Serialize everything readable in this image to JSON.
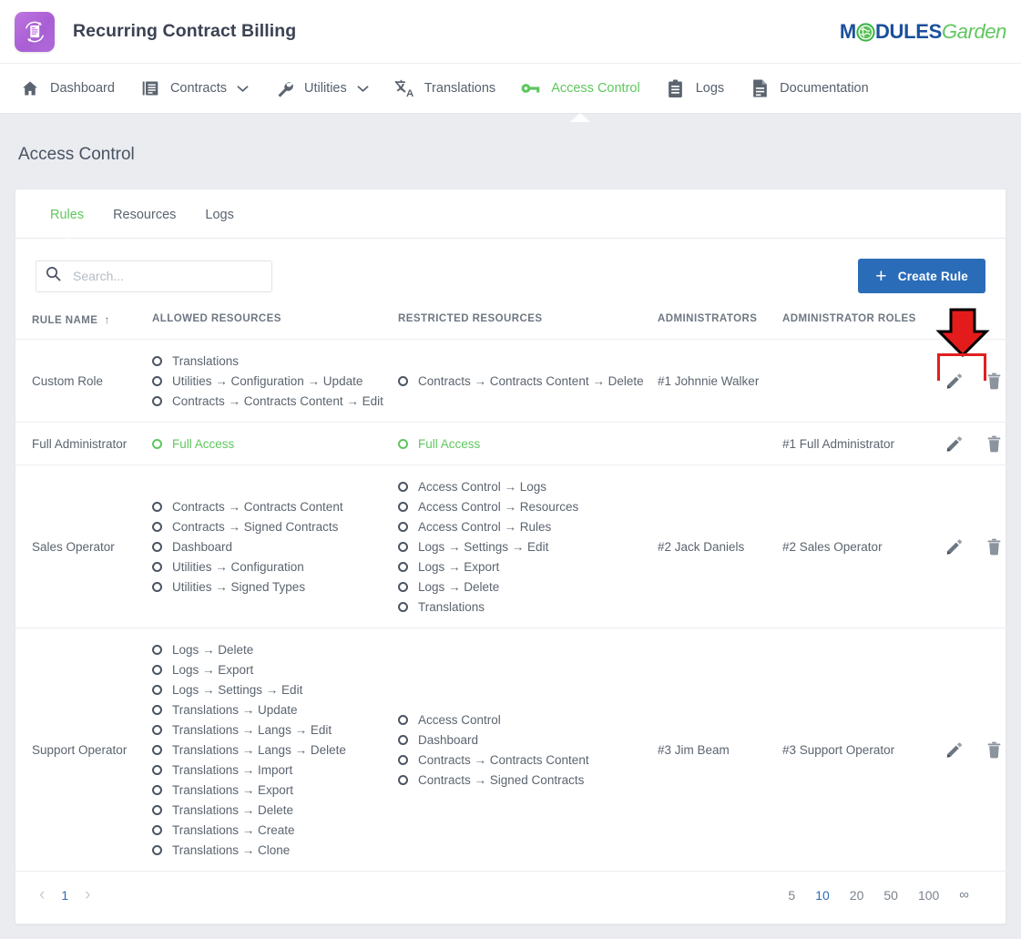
{
  "header": {
    "app_title": "Recurring Contract Billing",
    "app_icon": "recurring-document-icon",
    "logo": {
      "part1": "M",
      "part2": "DULES",
      "part3": "Garden"
    }
  },
  "nav": {
    "items": [
      {
        "label": "Dashboard",
        "icon": "home-icon",
        "active": false,
        "caret": false
      },
      {
        "label": "Contracts",
        "icon": "book-icon",
        "active": false,
        "caret": true
      },
      {
        "label": "Utilities",
        "icon": "wrench-icon",
        "active": false,
        "caret": true
      },
      {
        "label": "Translations",
        "icon": "translate-icon",
        "active": false,
        "caret": false
      },
      {
        "label": "Access Control",
        "icon": "key-icon",
        "active": true,
        "caret": false
      },
      {
        "label": "Logs",
        "icon": "clipboard-icon",
        "active": false,
        "caret": false
      },
      {
        "label": "Documentation",
        "icon": "document-icon",
        "active": false,
        "caret": false
      }
    ]
  },
  "page": {
    "title": "Access Control"
  },
  "tabs": [
    {
      "label": "Rules",
      "active": true
    },
    {
      "label": "Resources",
      "active": false
    },
    {
      "label": "Logs",
      "active": false
    }
  ],
  "toolbar": {
    "search_placeholder": "Search...",
    "search_value": "",
    "create_label": "Create Rule",
    "create_plus": "+"
  },
  "table": {
    "headers": {
      "rule_name": "RULE NAME",
      "sort_indicator": "↑",
      "allowed": "ALLOWED RESOURCES",
      "restricted": "RESTRICTED RESOURCES",
      "administrators": "ADMINISTRATORS",
      "administrator_roles": "ADMINISTRATOR ROLES",
      "actions": ""
    },
    "rows": [
      {
        "name": "Custom Role",
        "allowed": [
          {
            "text": "Translations",
            "full": false
          },
          {
            "text": "Utilities → Configuration → Update",
            "full": false
          },
          {
            "text": "Contracts → Contracts Content → Edit",
            "full": false
          }
        ],
        "restricted": [
          {
            "text": "Contracts → Contracts Content → Delete",
            "full": false
          }
        ],
        "administrators": "#1 Johnnie Walker",
        "administrator_roles": "",
        "edit_icon": "pencil-icon",
        "delete_icon": "trash-icon"
      },
      {
        "name": "Full Administrator",
        "allowed": [
          {
            "text": "Full Access",
            "full": true
          }
        ],
        "restricted": [
          {
            "text": "Full Access",
            "full": true
          }
        ],
        "administrators": "",
        "administrator_roles": "#1 Full Administrator",
        "edit_icon": "pencil-icon",
        "delete_icon": "trash-icon"
      },
      {
        "name": "Sales Operator",
        "allowed": [
          {
            "text": "Contracts → Contracts Content",
            "full": false
          },
          {
            "text": "Contracts → Signed Contracts",
            "full": false
          },
          {
            "text": "Dashboard",
            "full": false
          },
          {
            "text": "Utilities → Configuration",
            "full": false
          },
          {
            "text": "Utilities → Signed Types",
            "full": false
          }
        ],
        "restricted": [
          {
            "text": "Access Control → Logs",
            "full": false
          },
          {
            "text": "Access Control → Resources",
            "full": false
          },
          {
            "text": "Access Control → Rules",
            "full": false
          },
          {
            "text": "Logs → Settings → Edit",
            "full": false
          },
          {
            "text": "Logs → Export",
            "full": false
          },
          {
            "text": "Logs → Delete",
            "full": false
          },
          {
            "text": "Translations",
            "full": false
          }
        ],
        "administrators": "#2 Jack Daniels",
        "administrator_roles": "#2 Sales Operator",
        "edit_icon": "pencil-icon",
        "delete_icon": "trash-icon"
      },
      {
        "name": "Support Operator",
        "allowed": [
          {
            "text": "Logs → Delete",
            "full": false
          },
          {
            "text": "Logs → Export",
            "full": false
          },
          {
            "text": "Logs → Settings → Edit",
            "full": false
          },
          {
            "text": "Translations → Update",
            "full": false
          },
          {
            "text": "Translations → Langs → Edit",
            "full": false
          },
          {
            "text": "Translations → Langs → Delete",
            "full": false
          },
          {
            "text": "Translations → Import",
            "full": false
          },
          {
            "text": "Translations → Export",
            "full": false
          },
          {
            "text": "Translations → Delete",
            "full": false
          },
          {
            "text": "Translations → Create",
            "full": false
          },
          {
            "text": "Translations → Clone",
            "full": false
          }
        ],
        "restricted": [
          {
            "text": "Access Control",
            "full": false
          },
          {
            "text": "Dashboard",
            "full": false
          },
          {
            "text": "Contracts → Contracts Content",
            "full": false
          },
          {
            "text": "Contracts → Signed Contracts",
            "full": false
          }
        ],
        "administrators": "#3 Jim Beam",
        "administrator_roles": "#3 Support Operator",
        "edit_icon": "pencil-icon",
        "delete_icon": "trash-icon"
      }
    ]
  },
  "pagination": {
    "prev": "‹",
    "next": "›",
    "pages": [
      "1"
    ],
    "current_page": "1",
    "per_page_options": [
      "5",
      "10",
      "20",
      "50",
      "100",
      "∞"
    ],
    "per_page_selected": "10"
  },
  "annotation": {
    "arrow_color": "#e21f1f",
    "box_color": "#e21f1f",
    "target": "row-actions"
  },
  "colors": {
    "accent_green": "#5fc75f",
    "accent_blue": "#2b6cb8",
    "text": "#5b646f",
    "page_bg": "#eaecf0"
  }
}
